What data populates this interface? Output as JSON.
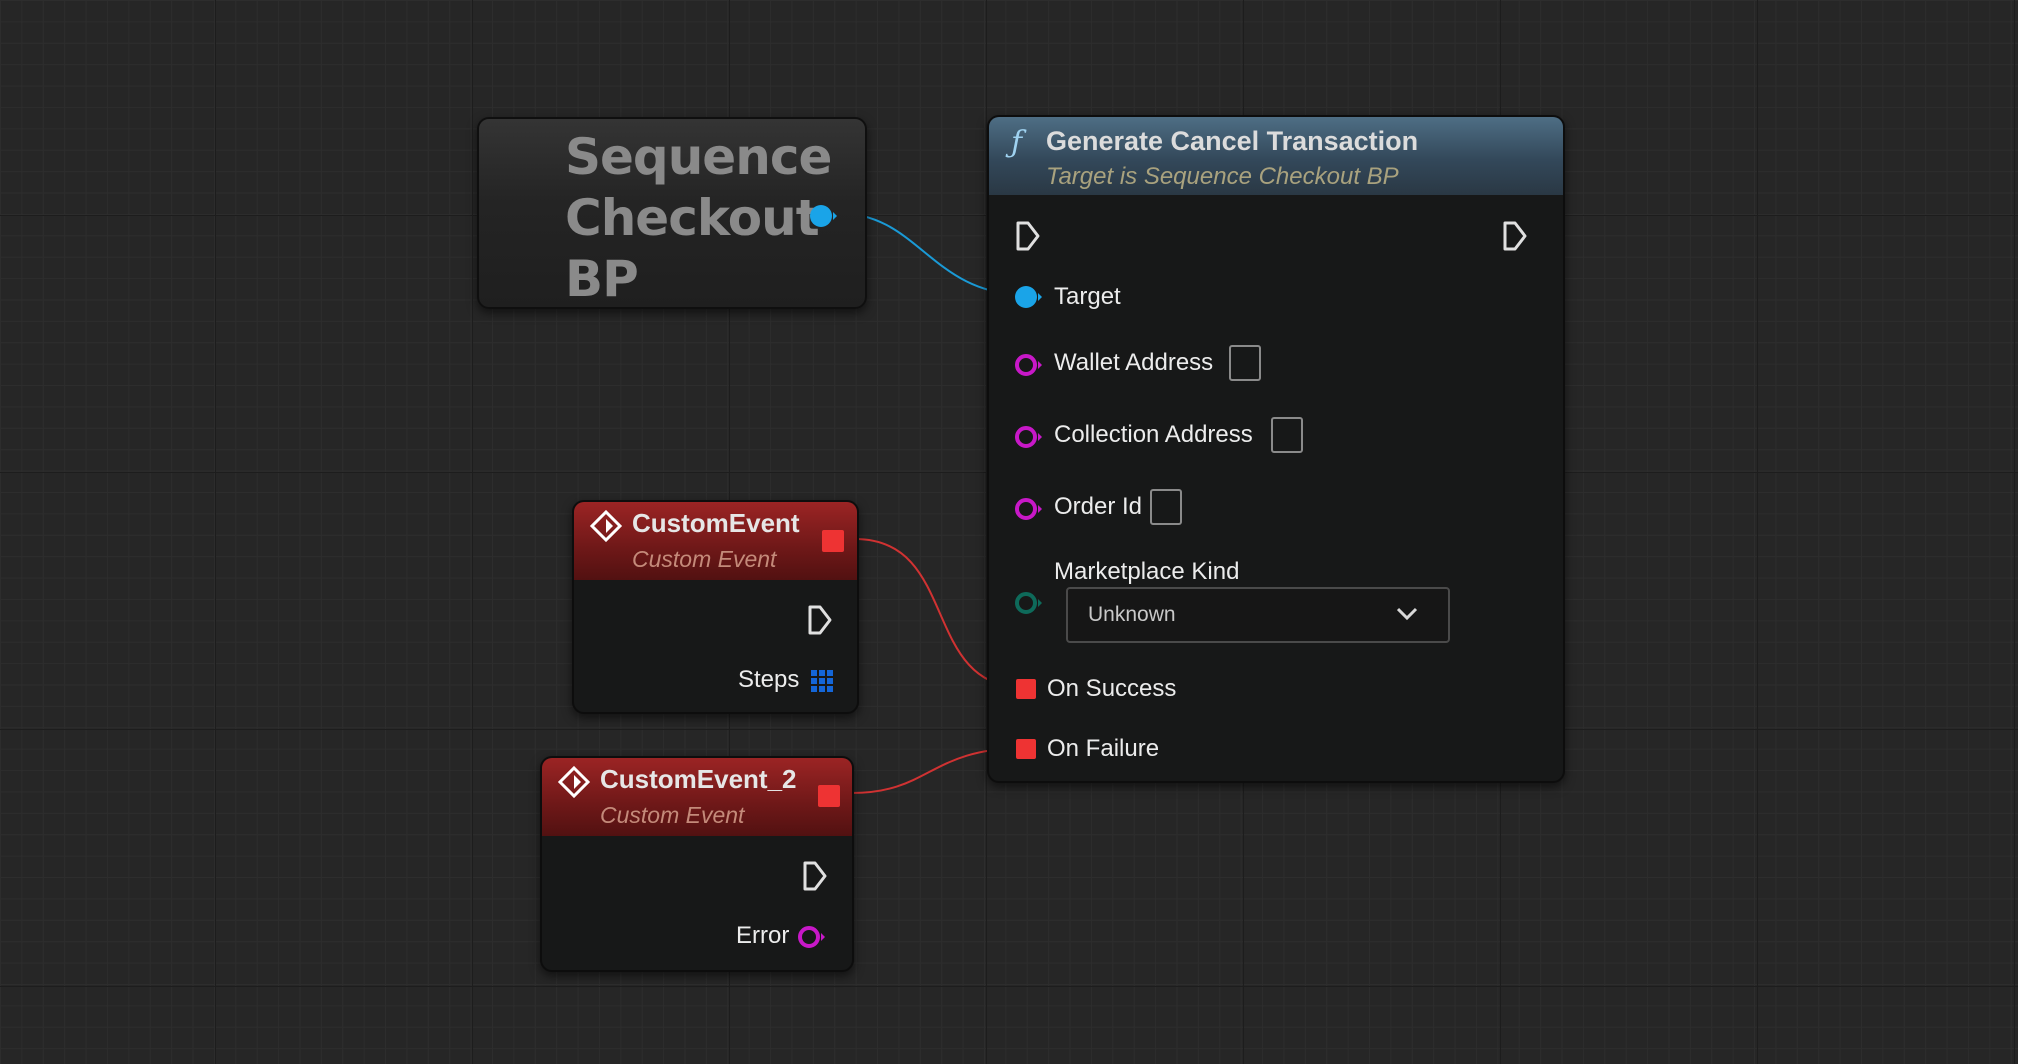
{
  "sequence_node": {
    "title_lines": [
      "Sequence",
      "Checkout",
      "BP"
    ],
    "pin_color": "#1aa4e8"
  },
  "function_node": {
    "title": "Generate Cancel Transaction",
    "subtitle": "Target is Sequence Checkout BP",
    "icon": "function-icon",
    "header_color": "#4e6e85",
    "pins": {
      "target": "Target",
      "wallet_address": "Wallet Address",
      "collection_address": "Collection Address",
      "order_id": "Order Id",
      "marketplace_kind": "Marketplace Kind",
      "marketplace_kind_value": "Unknown",
      "on_success": "On Success",
      "on_failure": "On Failure"
    },
    "string_pin_color": "#c818c8",
    "enum_pin_color": "#0e6a5a",
    "delegate_pin_color": "#ee3333"
  },
  "custom_event_1": {
    "title": "CustomEvent",
    "subtitle": "Custom Event",
    "output_label": "Steps",
    "output_pin_color": "#1466d8"
  },
  "custom_event_2": {
    "title": "CustomEvent_2",
    "subtitle": "Custom Event",
    "output_label": "Error",
    "output_pin_color": "#c818c8"
  },
  "event_header_color": "#9b2424"
}
